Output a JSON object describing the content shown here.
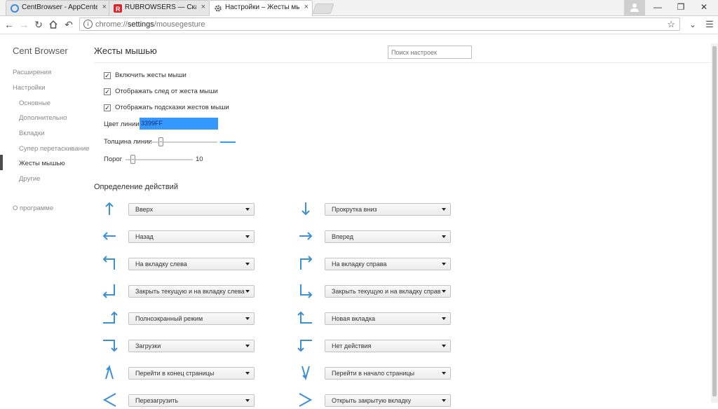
{
  "tabs": [
    {
      "title": "CentBrowser - AppCente",
      "favicon": "centbrowser-icon"
    },
    {
      "title": "RUBROWSERS — Скачат",
      "favicon": "rubrowsers-icon"
    },
    {
      "title": "Настройки – Жесты мыш",
      "favicon": "gear-icon"
    }
  ],
  "tab_close": "×",
  "omnibox": {
    "scheme": "chrome://",
    "host": "settings",
    "path": "/mousegesture"
  },
  "sidebar": {
    "title": "Cent Browser",
    "items": [
      {
        "label": "Расширения"
      },
      {
        "label": "Настройки"
      },
      {
        "label": "Основные"
      },
      {
        "label": "Дополнительно"
      },
      {
        "label": "Вкладки"
      },
      {
        "label": "Супер перетаскивание"
      },
      {
        "label": "Жесты мышью"
      },
      {
        "label": "Другие"
      },
      {
        "label": "О программе"
      }
    ]
  },
  "main": {
    "title": "Жесты мышью",
    "search_placeholder": "Поиск настроек",
    "checkboxes": [
      {
        "label": "Включить жесты мыши",
        "checked": true
      },
      {
        "label": "Отображать след от жеста мыши",
        "checked": true
      },
      {
        "label": "Отображать подсказки жестов мыши",
        "checked": true
      }
    ],
    "line_color_label": "Цвет линии",
    "line_color_value": "3399FF",
    "line_width_label": "Толщина линии",
    "line_width_fraction": 0.15,
    "threshold_label": "Порог",
    "threshold_value": "10",
    "threshold_fraction": 0.1,
    "section_title": "Определение действий",
    "gestures_left": [
      {
        "icon": "arrow-up-icon",
        "action": "Вверх"
      },
      {
        "icon": "arrow-left-icon",
        "action": "Назад"
      },
      {
        "icon": "arrow-up-left-icon",
        "action": "На вкладку слева"
      },
      {
        "icon": "arrow-down-left-icon",
        "action": "Закрыть текущую и на вкладку слева"
      },
      {
        "icon": "arrow-right-up-icon",
        "action": "Полноэкранный режим"
      },
      {
        "icon": "arrow-right-down-icon",
        "action": "Загрузки"
      },
      {
        "icon": "arrow-up-down-icon",
        "action": "Перейти в конец страницы"
      },
      {
        "icon": "arrow-left-right-icon",
        "action": "Перезагрузить"
      }
    ],
    "gestures_right": [
      {
        "icon": "arrow-down-icon",
        "action": "Прокрутка вниз"
      },
      {
        "icon": "arrow-right-icon",
        "action": "Вперед"
      },
      {
        "icon": "arrow-up-right-icon",
        "action": "На вкладку справа"
      },
      {
        "icon": "arrow-down-right-icon",
        "action": "Закрыть текущую и на вкладку справ"
      },
      {
        "icon": "arrow-left-up-icon",
        "action": "Новая вкладка"
      },
      {
        "icon": "arrow-left-down-icon",
        "action": "Нет действия"
      },
      {
        "icon": "arrow-down-up-icon",
        "action": "Перейти в начало страницы"
      },
      {
        "icon": "arrow-right-left-icon",
        "action": "Открыть закрытую вкладку"
      }
    ]
  },
  "colors": {
    "accent": "#3399ff",
    "icon_blue": "#3d8fd6"
  }
}
